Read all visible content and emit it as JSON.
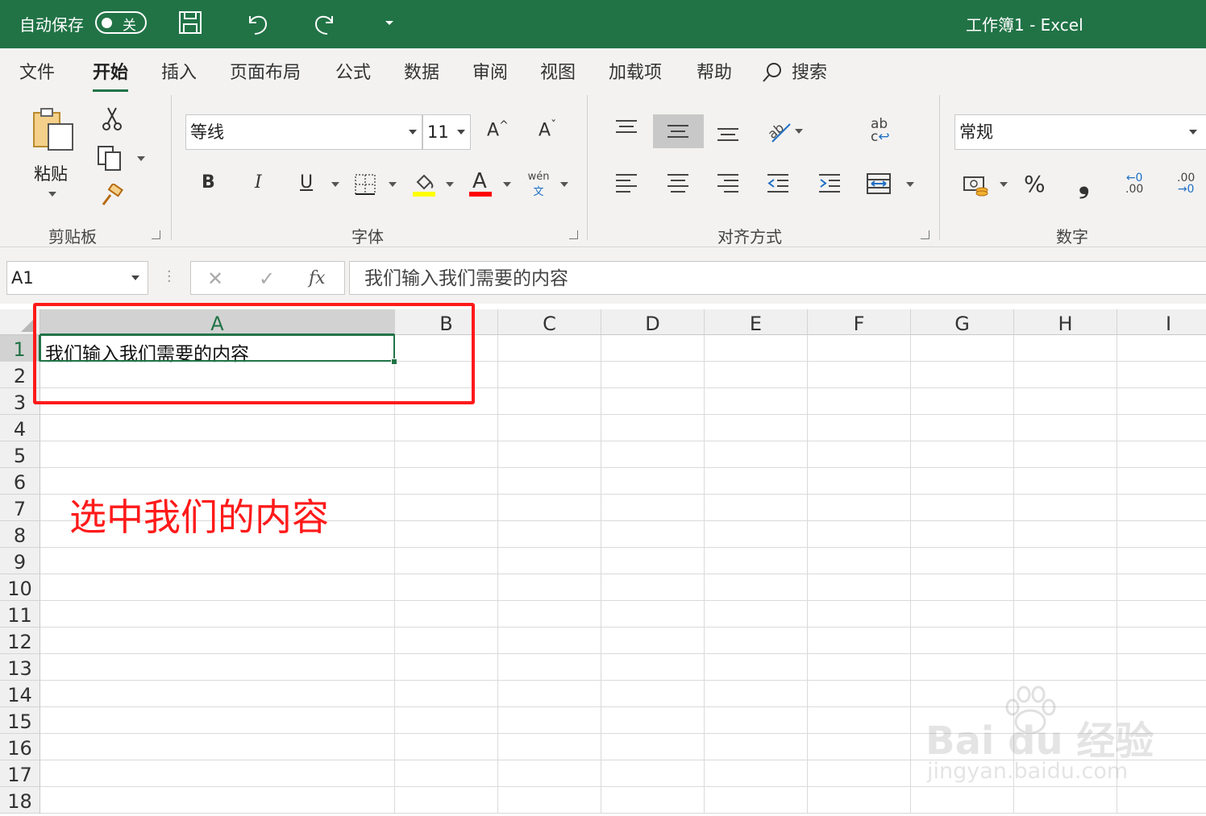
{
  "titlebar": {
    "autosave_label": "自动保存",
    "autosave_state": "关",
    "doc_title": "工作簿1  -  Excel"
  },
  "tabs": [
    "文件",
    "开始",
    "插入",
    "页面布局",
    "公式",
    "数据",
    "审阅",
    "视图",
    "加载项",
    "帮助"
  ],
  "active_tab": "开始",
  "search_label": "搜索",
  "ribbon": {
    "clipboard": {
      "paste_label": "粘贴",
      "group_label": "剪贴板"
    },
    "font": {
      "font_name": "等线",
      "font_size": "11",
      "group_label": "字体",
      "bold": "B",
      "italic": "I",
      "underline": "U",
      "font_color_glyph": "A",
      "phonetic_top": "wén",
      "phonetic_bottom": "文",
      "grow_font": "A",
      "shrink_font": "A"
    },
    "alignment": {
      "group_label": "对齐方式",
      "wrap_text_top": "ab",
      "wrap_text_bottom": "c"
    },
    "number": {
      "format": "常规",
      "group_label": "数字",
      "percent": "%",
      "comma": "❟",
      "inc_decimal_top": "←0",
      "inc_decimal_bottom": ".00",
      "dec_decimal_top": ".00",
      "dec_decimal_bottom": "→0"
    }
  },
  "formula_bar": {
    "name_box": "A1",
    "fx": "fx",
    "content": "我们输入我们需要的内容"
  },
  "grid": {
    "columns": [
      "A",
      "B",
      "C",
      "D",
      "E",
      "F",
      "G",
      "H",
      "I"
    ],
    "rows": [
      "1",
      "2",
      "3",
      "4",
      "5",
      "6",
      "7",
      "8",
      "9",
      "10",
      "11",
      "12",
      "13",
      "14",
      "15",
      "16",
      "17",
      "18"
    ],
    "cell_A1": "我们输入我们需要的内容"
  },
  "annotation": {
    "text": "选中我们的内容",
    "color": "#ff1a1a"
  },
  "watermark": {
    "brand": "Bai du 经验",
    "url": "jingyan.baidu.com"
  },
  "colors": {
    "excel_green": "#217346",
    "highlight_yellow": "#ffff00",
    "font_red": "#ff0000"
  }
}
